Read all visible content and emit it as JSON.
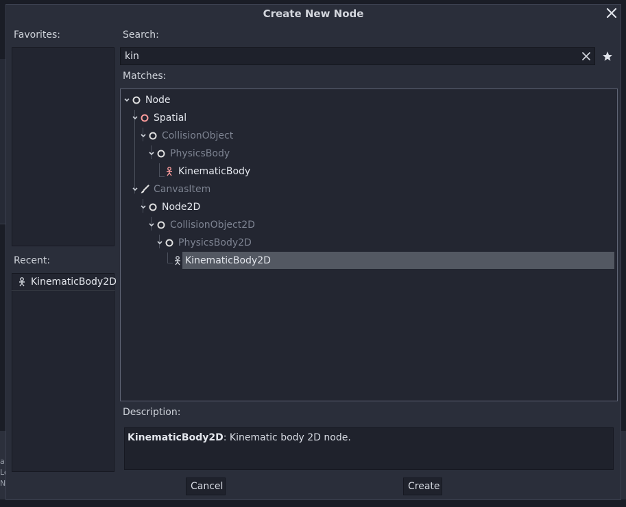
{
  "colors": {
    "dialog_bg": "#2a2e3a",
    "selected_row": "#535862",
    "spatial_icon": "#fc9c9c",
    "node_icon": "#e0e0e0",
    "dim_text": "#7d8391"
  },
  "dialog": {
    "title": "Create New Node",
    "close_icon": "close-icon"
  },
  "favorites": {
    "label": "Favorites:"
  },
  "recent": {
    "label": "Recent:",
    "items": [
      {
        "label": "KinematicBody2D",
        "icon": "kinematic-body-2d-icon"
      }
    ]
  },
  "search": {
    "label": "Search:",
    "value": "kin",
    "clear_icon": "clear-icon",
    "favorite_icon": "star-icon"
  },
  "matches": {
    "label": "Matches:",
    "nodes": [
      {
        "label": "Node",
        "icon": "node-icon",
        "state": "normal"
      },
      {
        "label": "Spatial",
        "icon": "spatial-icon",
        "state": "normal"
      },
      {
        "label": "CollisionObject",
        "icon": "node-icon",
        "state": "dim"
      },
      {
        "label": "PhysicsBody",
        "icon": "node-icon",
        "state": "dim"
      },
      {
        "label": "KinematicBody",
        "icon": "kinematic-body-icon",
        "state": "normal"
      },
      {
        "label": "CanvasItem",
        "icon": "canvas-item-icon",
        "state": "dim"
      },
      {
        "label": "Node2D",
        "icon": "node-icon",
        "state": "normal"
      },
      {
        "label": "CollisionObject2D",
        "icon": "node-icon",
        "state": "dim"
      },
      {
        "label": "PhysicsBody2D",
        "icon": "node-icon",
        "state": "dim"
      },
      {
        "label": "KinematicBody2D",
        "icon": "kinematic-body-2d-icon",
        "state": "selected"
      }
    ]
  },
  "description": {
    "label": "Description:",
    "name": "KinematicBody2D",
    "text": ": Kinematic body 2D node."
  },
  "buttons": {
    "cancel": "Cancel",
    "create": "Create"
  },
  "background": {
    "bottom_fragments": [
      "a",
      "Le",
      "N"
    ]
  }
}
